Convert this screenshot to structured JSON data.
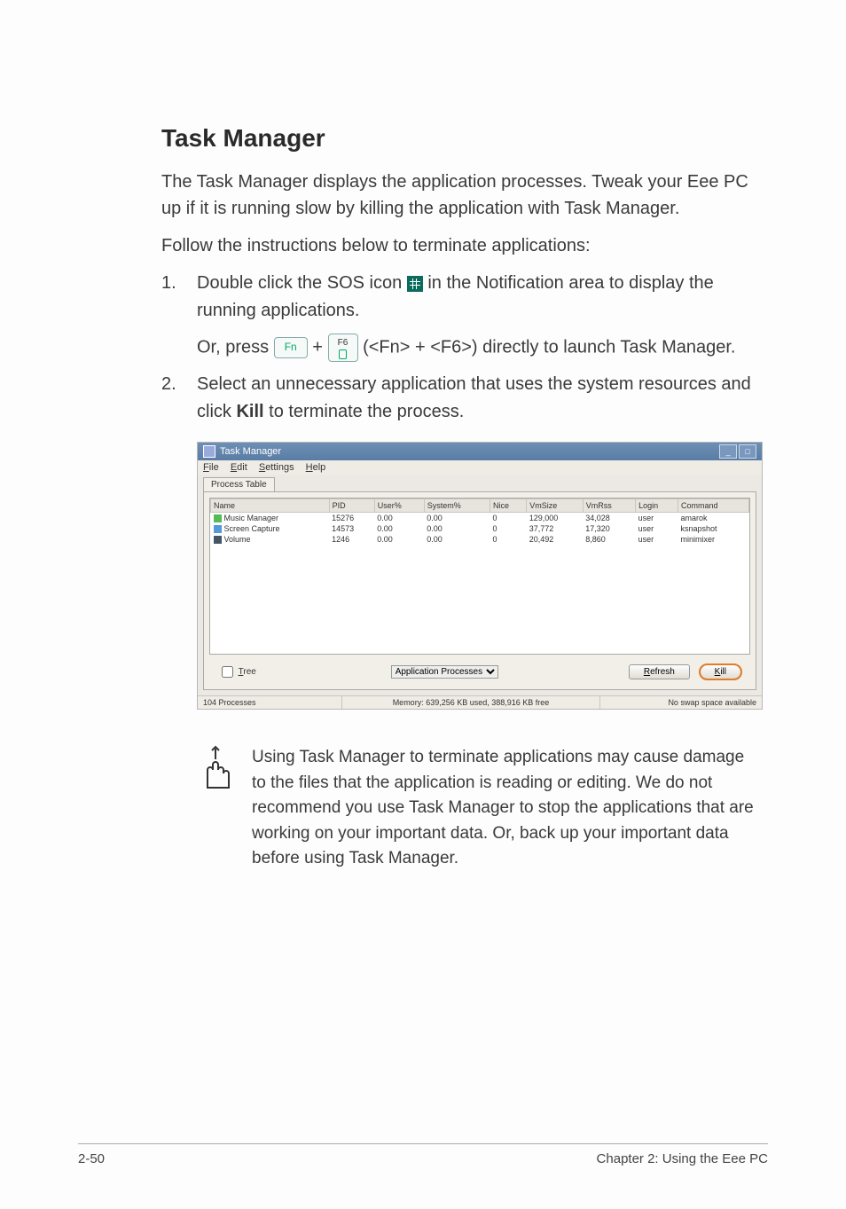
{
  "heading": "Task Manager",
  "intro": "The Task Manager displays the application processes. Tweak your Eee PC up if it is running slow by killing the application with Task Manager.",
  "instruction_lead": "Follow the instructions below to terminate applications:",
  "step1_num": "1.",
  "step1_a": "Double click the SOS icon ",
  "step1_b": " in the Notification area to display the running applications.",
  "step1_or_a": "Or, press ",
  "step1_key1": "Fn",
  "step1_plus": " + ",
  "step1_key2_top": "F6",
  "step1_or_b": " (<Fn> + <F6>) directly to launch Task Manager.",
  "step2_num": "2.",
  "step2_a": "Select an unnecessary application that uses the system resources and click ",
  "step2_bold": "Kill",
  "step2_b": " to terminate the process.",
  "shot": {
    "title": "Task Manager",
    "menu": {
      "file": "File",
      "edit": "Edit",
      "settings": "Settings",
      "help": "Help"
    },
    "tab": "Process Table",
    "cols": [
      "Name",
      "PID",
      "User%",
      "System%",
      "Nice",
      "VmSize",
      "VmRss",
      "Login",
      "Command"
    ],
    "rows": [
      {
        "icon": "ic-green",
        "name": "Music Manager",
        "pid": "15276",
        "u": "0.00",
        "s": "0.00",
        "n": "0",
        "vs": "129,000",
        "vr": "34,028",
        "login": "user",
        "cmd": "amarok"
      },
      {
        "icon": "ic-blue",
        "name": "Screen Capture",
        "pid": "14573",
        "u": "0.00",
        "s": "0.00",
        "n": "0",
        "vs": "37,772",
        "vr": "17,320",
        "login": "user",
        "cmd": "ksnapshot"
      },
      {
        "icon": "ic-dark",
        "name": "Volume",
        "pid": "1246",
        "u": "0.00",
        "s": "0.00",
        "n": "0",
        "vs": "20,492",
        "vr": "8,860",
        "login": "user",
        "cmd": "minimixer"
      }
    ],
    "tree_label": "Tree",
    "filter": "Application Processes",
    "refresh": "Refresh",
    "kill": "Kill",
    "status_left": "104 Processes",
    "status_mid": "Memory: 639,256 KB used, 388,916 KB free",
    "status_right": "No swap space available"
  },
  "note": "Using Task Manager to terminate applications may cause damage to the files that the application is reading or editing. We do not recommend you use Task Manager to stop the applications that are working on your important data. Or, back up your important data before using Task Manager.",
  "footer_left": "2-50",
  "footer_right": "Chapter 2: Using the Eee PC"
}
